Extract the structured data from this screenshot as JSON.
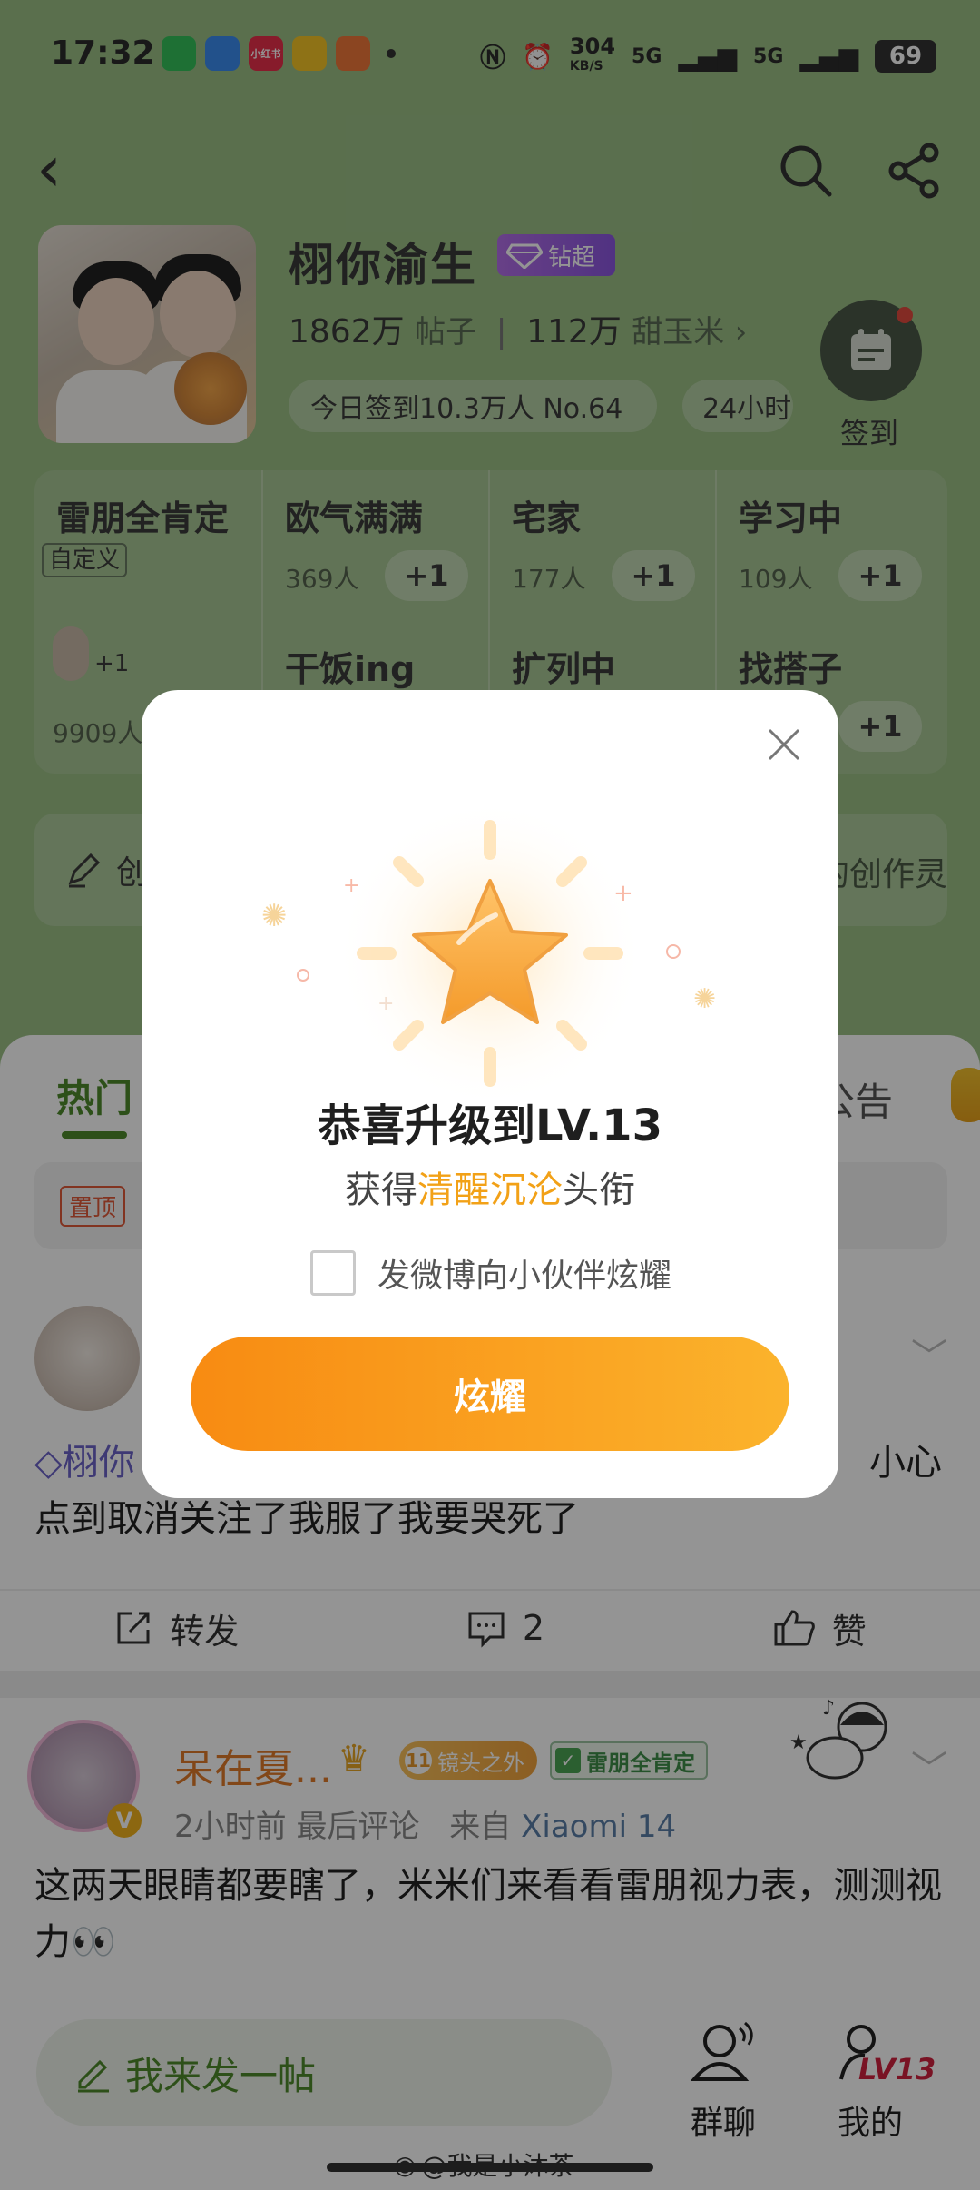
{
  "status_bar": {
    "time": "17:32",
    "net_speed": "304",
    "net_unit": "KB/S",
    "signal1": "5G",
    "signal2": "5G",
    "battery": "69",
    "apps": [
      {
        "label": "",
        "color": "#35c15b"
      },
      {
        "label": "",
        "color": "#3b8cf0"
      },
      {
        "label": "小红书",
        "color": "#e8304a"
      },
      {
        "label": "",
        "color": "#f4c527"
      },
      {
        "label": "",
        "color": "#f0783a"
      }
    ]
  },
  "header": {
    "title": "栩你渝生",
    "badge": "钻超",
    "posts_count": "1862万",
    "posts_unit": "帖子",
    "fans_count": "112万",
    "fans_unit": "甜玉米",
    "fans_arrow": "›",
    "checkin_pill": "今日签到10.3万人 No.64",
    "pill_2": "24小时",
    "checkin_label": "签到"
  },
  "tags": {
    "big": {
      "name": "雷朋全肯定",
      "custom": "自定义",
      "plus": "+1",
      "count": "9909人"
    },
    "cells": [
      {
        "name": "欧气满满",
        "count": "369人",
        "plus": "+1"
      },
      {
        "name": "宅家",
        "count": "177人",
        "plus": "+1"
      },
      {
        "name": "学习中",
        "count": "109人",
        "plus": "+1"
      },
      {
        "name": "干饭ing",
        "count": "",
        "plus": ""
      },
      {
        "name": "扩列中",
        "count": "",
        "plus": ""
      },
      {
        "name": "找搭子",
        "count": "",
        "plus": "+1"
      }
    ]
  },
  "create_bar": {
    "left": "创",
    "right": "的创作灵"
  },
  "feed": {
    "tab_hot": "热门",
    "tab_notice": "公告",
    "pinned_badge": "置顶",
    "post1": {
      "text_prefix": "栩你",
      "text_suffix": "小心",
      "text_line2": "点到取消关注了我服了我要哭死了",
      "repost": "转发",
      "comments": "2",
      "like": "赞"
    },
    "post2": {
      "name": "呆在夏...",
      "level": "11",
      "level_title": "镜头之外",
      "fan_title": "雷朋全肯定",
      "time": "2小时前 最后评论",
      "source_prefix": "来自",
      "device": "Xiaomi 14",
      "text": "这两天眼睛都要瞎了，米米们来看看雷朋视力表，测测视力👀"
    }
  },
  "bottom": {
    "compose": "我来发一帖",
    "group_chat": "群聊",
    "mine": "我的",
    "level": "LV13"
  },
  "watermark": "@我是小沐茶",
  "modal": {
    "title": "恭喜升级到LV.13",
    "sub_before": "获得",
    "sub_highlight": "清醒沉沦",
    "sub_after": "头衔",
    "checkbox_label": "发微博向小伙伴炫耀",
    "button_label": "炫耀"
  }
}
